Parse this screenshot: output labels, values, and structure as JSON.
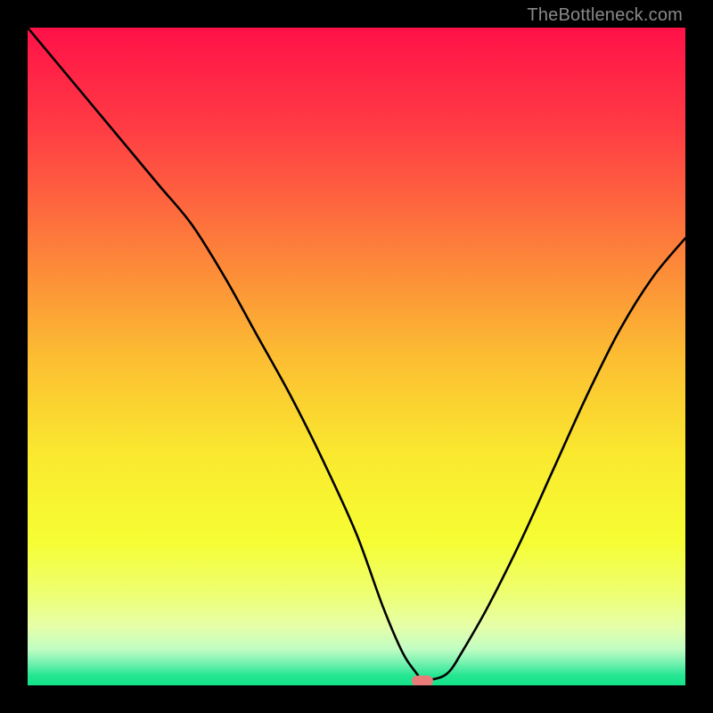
{
  "watermark": "TheBottleneck.com",
  "chart_data": {
    "type": "line",
    "title": "",
    "xlabel": "",
    "ylabel": "",
    "xlim": [
      0,
      100
    ],
    "ylim": [
      0,
      100
    ],
    "grid": false,
    "legend": false,
    "background": {
      "type": "vertical-gradient",
      "stops": [
        {
          "pos": 0.0,
          "color": "#ff1148"
        },
        {
          "pos": 0.15,
          "color": "#ff3b44"
        },
        {
          "pos": 0.33,
          "color": "#fd7d3b"
        },
        {
          "pos": 0.5,
          "color": "#fcbd32"
        },
        {
          "pos": 0.65,
          "color": "#fae92f"
        },
        {
          "pos": 0.78,
          "color": "#f6fd33"
        },
        {
          "pos": 0.86,
          "color": "#eeff71"
        },
        {
          "pos": 0.91,
          "color": "#e6ffa8"
        },
        {
          "pos": 0.945,
          "color": "#c1fdc3"
        },
        {
          "pos": 0.965,
          "color": "#79f2b1"
        },
        {
          "pos": 0.985,
          "color": "#25e693"
        },
        {
          "pos": 1.0,
          "color": "#13e288"
        }
      ]
    },
    "series": [
      {
        "name": "bottleneck-curve",
        "color": "#000000",
        "x": [
          0,
          5,
          10,
          15,
          20,
          25,
          30,
          35,
          40,
          45,
          50,
          54,
          57,
          59,
          60,
          62,
          64,
          66,
          70,
          75,
          80,
          85,
          90,
          95,
          100
        ],
        "y": [
          100,
          94,
          88,
          82,
          76,
          70,
          62,
          53,
          44,
          34,
          23,
          12,
          5,
          2,
          1,
          1,
          2,
          5,
          12,
          22,
          33,
          44,
          54,
          62,
          68
        ]
      }
    ],
    "marker": {
      "name": "optimal-point",
      "x": 60,
      "y": 0.7,
      "color": "#e77c79"
    }
  }
}
